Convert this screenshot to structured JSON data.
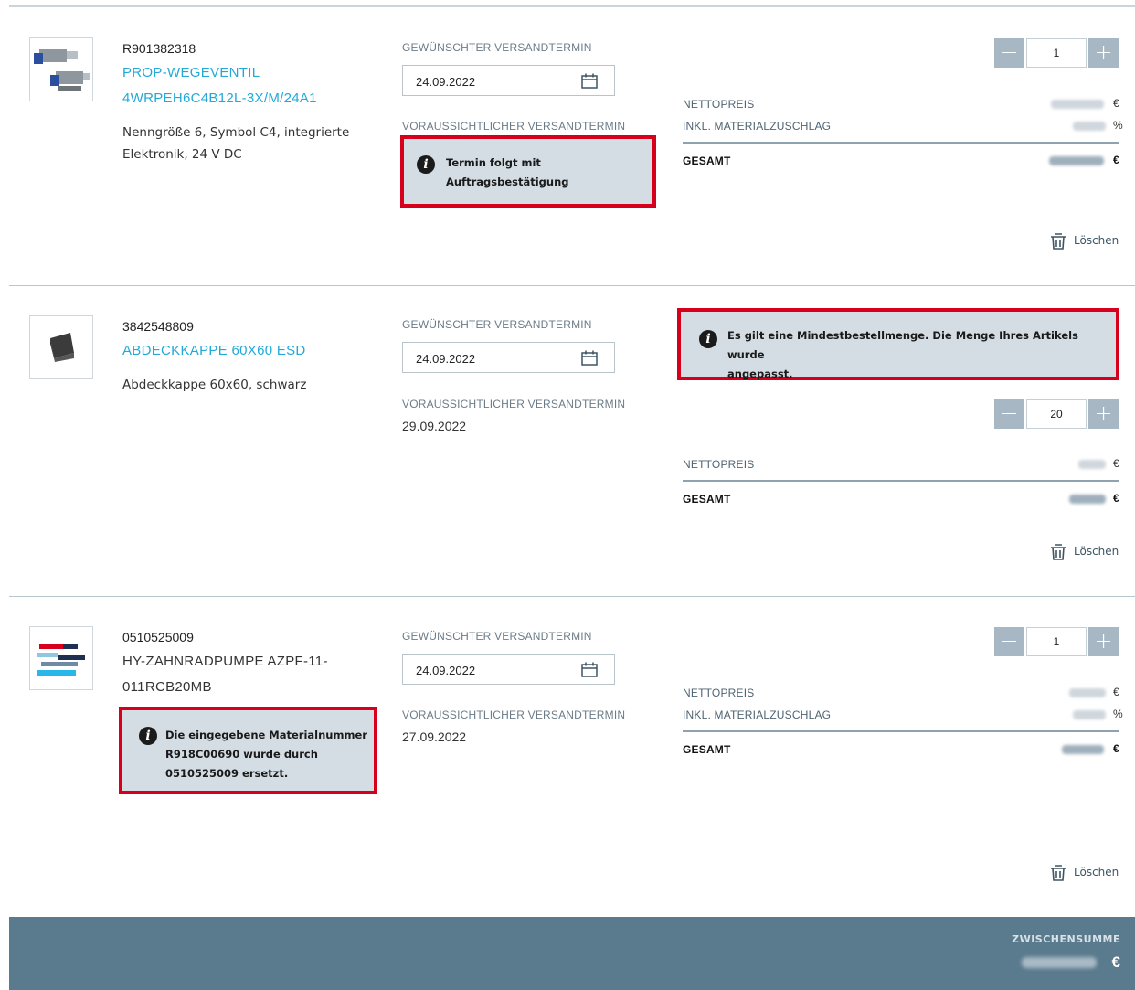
{
  "items": [
    {
      "material_number": "R901382318",
      "name_line1": "PROP-WEGEVENTIL",
      "name_line2": "4WRPEH6C4B12L-3X/M/24A1",
      "description_line1": "Nenngröße 6, Symbol C4, integrierte",
      "description_line2": "Elektronik, 24 V DC",
      "requested_label": "GEWÜNSCHTER VERSANDTERMIN",
      "requested_date": "24.09.2022",
      "expected_label": "VORAUSSICHTLICHER VERSANDTERMIN",
      "notice_line1": "Termin folgt mit",
      "notice_line2": "Auftragsbestätigung",
      "quantity": "1",
      "net_label": "NETTOPREIS",
      "net_unit": "€",
      "surcharge_label": "INKL. MATERIALZUSCHLAG",
      "surcharge_unit": "%",
      "total_label": "GESAMT",
      "total_unit": "€",
      "delete_label": "Löschen"
    },
    {
      "material_number": "3842548809",
      "name_line1": "ABDECKKAPPE 60X60 ESD",
      "description_line1": "Abdeckkappe 60x60, schwarz",
      "requested_label": "GEWÜNSCHTER VERSANDTERMIN",
      "requested_date": "24.09.2022",
      "expected_label": "VORAUSSICHTLICHER VERSANDTERMIN",
      "expected_date": "29.09.2022",
      "notice_line1": "Es gilt eine Mindestbestellmenge. Die Menge Ihres Artikels wurde",
      "notice_line2": "angepasst.",
      "quantity": "20",
      "net_label": "NETTOPREIS",
      "net_unit": "€",
      "total_label": "GESAMT",
      "total_unit": "€",
      "delete_label": "Löschen"
    },
    {
      "material_number": "0510525009",
      "name_line1": "HY-ZAHNRADPUMPE AZPF-11-",
      "name_line2": "011RCB20MB",
      "notice_line1": "Die eingegebene Materialnummer",
      "notice_line2": "R918C00690 wurde durch",
      "notice_line3": "0510525009 ersetzt.",
      "requested_label": "GEWÜNSCHTER VERSANDTERMIN",
      "requested_date": "24.09.2022",
      "expected_label": "VORAUSSICHTLICHER VERSANDTERMIN",
      "expected_date": "27.09.2022",
      "quantity": "1",
      "net_label": "NETTOPREIS",
      "net_unit": "€",
      "surcharge_label": "INKL. MATERIALZUSCHLAG",
      "surcharge_unit": "%",
      "total_label": "GESAMT",
      "total_unit": "€",
      "delete_label": "Löschen"
    }
  ],
  "footer": {
    "subtotal_label": "ZWISCHENSUMME",
    "subtotal_unit": "€"
  },
  "colors": {
    "link": "#22a9d8",
    "highlight": "#d6001c",
    "notice_bg": "#d4dde3",
    "footer_bg": "#5a7a8d",
    "qty_button": "#a7b7c3"
  },
  "icons": {
    "info": "info-icon",
    "calendar": "calendar-icon",
    "trash": "trash-icon",
    "minus": "minus-icon",
    "plus": "plus-icon"
  },
  "glyphs": {
    "info": "i",
    "minus": "−",
    "plus": "+"
  }
}
